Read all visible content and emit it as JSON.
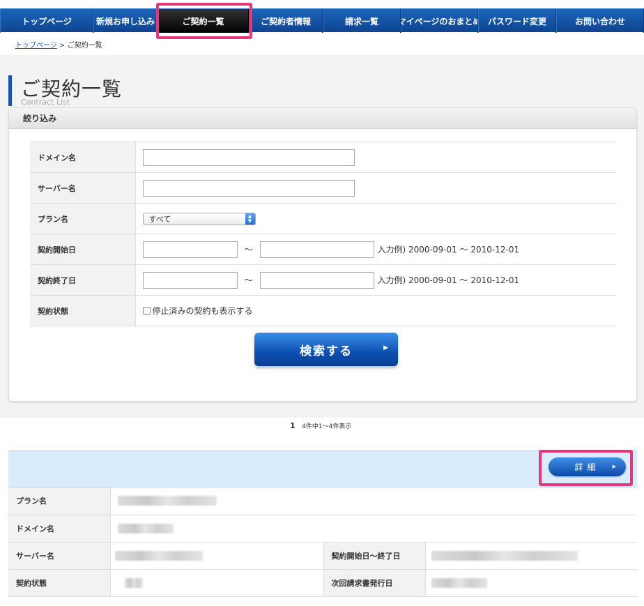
{
  "nav": {
    "items": [
      {
        "label": "トップページ"
      },
      {
        "label": "新規お申し込み"
      },
      {
        "label": "ご契約一覧"
      },
      {
        "label": "ご契約者情報"
      },
      {
        "label": "請求一覧"
      },
      {
        "label": "マイページのおまとめ"
      },
      {
        "label": "パスワード変更"
      },
      {
        "label": "お問い合わせ"
      }
    ],
    "active": "ご契約一覧"
  },
  "breadcrumb": {
    "home": "トップページ",
    "separator": ">",
    "current": "ご契約一覧"
  },
  "page": {
    "title": "ご契約一覧",
    "subtitle": "Contract List"
  },
  "filter": {
    "heading": "絞り込み",
    "rows": {
      "domain": {
        "label": "ドメイン名",
        "value": ""
      },
      "server": {
        "label": "サーバー名",
        "value": ""
      },
      "plan": {
        "label": "プラン名",
        "selected": "すべて"
      },
      "start": {
        "label": "契約開始日",
        "from": "",
        "to": "",
        "tilde": "〜",
        "hint": "入力例) 2000-09-01 〜 2010-12-01"
      },
      "end": {
        "label": "契約終了日",
        "from": "",
        "to": "",
        "tilde": "〜",
        "hint": "入力例) 2000-09-01 〜 2010-12-01"
      },
      "status": {
        "label": "契約状態",
        "checkbox_label": "停止済みの契約も表示する",
        "checked": false
      }
    },
    "search_button": "検索する"
  },
  "pager": {
    "current": "1",
    "info": "4件中1〜4件表示"
  },
  "result": {
    "detail_button": "詳細",
    "labels": {
      "plan": "プラン名",
      "domain": "ドメイン名",
      "server": "サーバー名",
      "period": "契約開始日〜終了日",
      "status": "契約状態",
      "next_invoice": "次回請求書発行日"
    }
  },
  "colors": {
    "nav_blue": "#1d64b8",
    "highlight": "#e8347a",
    "accent": "#1755a6",
    "result_head": "#d9ecfb"
  }
}
